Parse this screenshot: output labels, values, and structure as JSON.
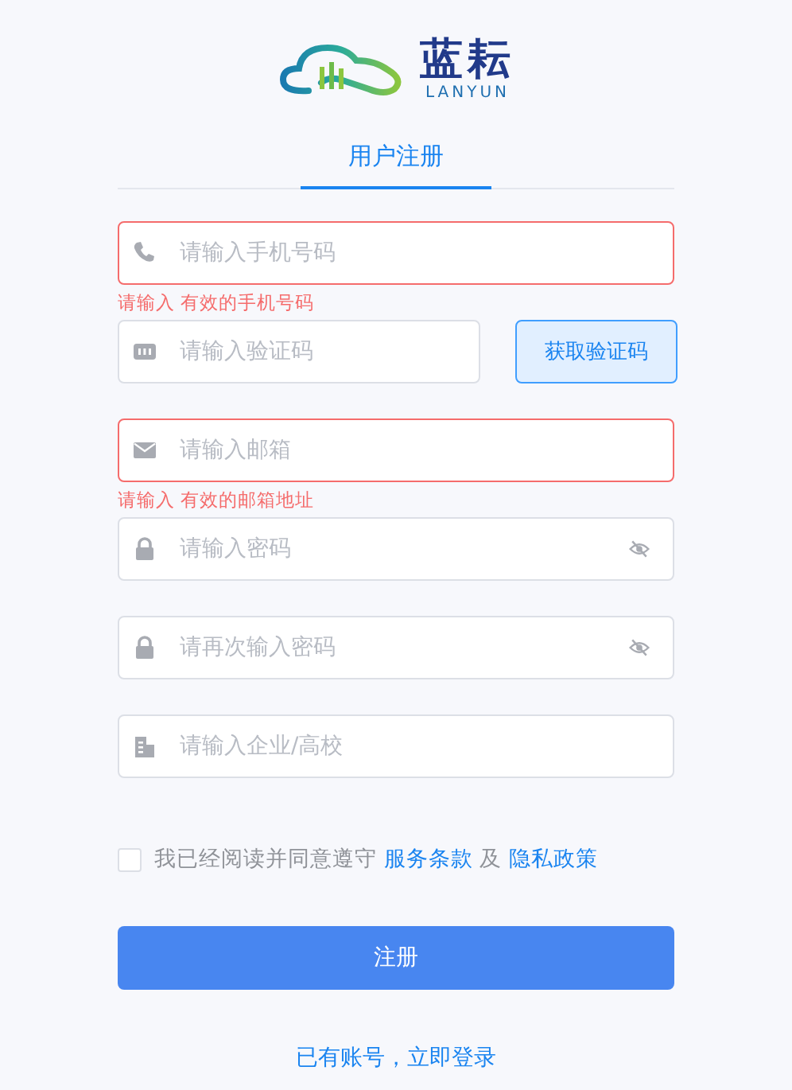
{
  "logo": {
    "name": "蓝耘",
    "subtitle": "LANYUN"
  },
  "tabs": [
    {
      "label": "用户注册",
      "selected": true
    }
  ],
  "fields": [
    {
      "kind": "phone",
      "placeholder": "请输入手机号码",
      "invalid": true,
      "error": "请输入 有效的手机号码"
    },
    {
      "kind": "code",
      "placeholder": "请输入验证码",
      "invalid": false,
      "button": "获取验证码"
    },
    {
      "kind": "email",
      "placeholder": "请输入邮箱",
      "invalid": true,
      "error": "请输入 有效的邮箱地址"
    },
    {
      "kind": "password",
      "placeholder": "请输入密码",
      "invalid": false
    },
    {
      "kind": "password",
      "placeholder": "请再次输入密码",
      "invalid": false
    },
    {
      "kind": "company",
      "placeholder": "请输入企业/高校",
      "invalid": false
    }
  ],
  "agreement": {
    "checked": false,
    "text": "我已经阅读并同意遵守",
    "terms": "服务条款",
    "joiner": "及",
    "privacy": "隐私政策"
  },
  "submit": "注册",
  "login_link": "已有账号，立即登录"
}
